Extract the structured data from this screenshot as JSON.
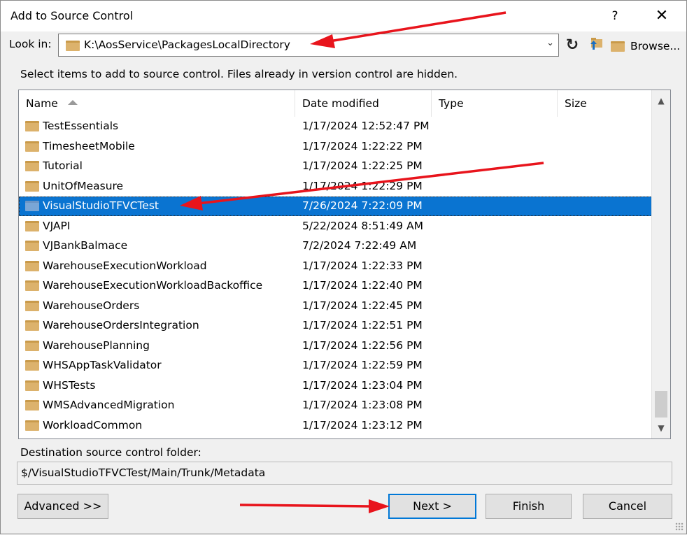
{
  "window": {
    "title": "Add to Source Control",
    "help": "?",
    "close": "✕"
  },
  "lookin": {
    "label": "Look in:",
    "path": "K:\\AosService\\PackagesLocalDirectory",
    "browse_label": "Browse..."
  },
  "instructions": "Select items to add to source control. Files already in version control are hidden.",
  "columns": [
    "Name",
    "Date modified",
    "Type",
    "Size"
  ],
  "rows": [
    {
      "name": "TestEssentials",
      "date": "1/17/2024 12:52:47 PM"
    },
    {
      "name": "TimesheetMobile",
      "date": "1/17/2024 1:22:22 PM"
    },
    {
      "name": "Tutorial",
      "date": "1/17/2024 1:22:25 PM"
    },
    {
      "name": "UnitOfMeasure",
      "date": "1/17/2024 1:22:29 PM"
    },
    {
      "name": "VisualStudioTFVCTest",
      "date": "7/26/2024 7:22:09 PM",
      "selected": true
    },
    {
      "name": "VJAPI",
      "date": "5/22/2024 8:51:49 AM"
    },
    {
      "name": "VJBankBalmace",
      "date": "7/2/2024 7:22:49 AM"
    },
    {
      "name": "WarehouseExecutionWorkload",
      "date": "1/17/2024 1:22:33 PM"
    },
    {
      "name": "WarehouseExecutionWorkloadBackoffice",
      "date": "1/17/2024 1:22:40 PM"
    },
    {
      "name": "WarehouseOrders",
      "date": "1/17/2024 1:22:45 PM"
    },
    {
      "name": "WarehouseOrdersIntegration",
      "date": "1/17/2024 1:22:51 PM"
    },
    {
      "name": "WarehousePlanning",
      "date": "1/17/2024 1:22:56 PM"
    },
    {
      "name": "WHSAppTaskValidator",
      "date": "1/17/2024 1:22:59 PM"
    },
    {
      "name": "WHSTests",
      "date": "1/17/2024 1:23:04 PM"
    },
    {
      "name": "WMSAdvancedMigration",
      "date": "1/17/2024 1:23:08 PM"
    },
    {
      "name": "WorkloadCommon",
      "date": "1/17/2024 1:23:12 PM"
    }
  ],
  "destination": {
    "label": "Destination source control folder:",
    "value": "$/VisualStudioTFVCTest/Main/Trunk/Metadata"
  },
  "buttons": {
    "advanced": "Advanced >>",
    "next": "Next >",
    "finish": "Finish",
    "cancel": "Cancel"
  },
  "colors": {
    "selection": "#0a74d1",
    "annotation_arrow": "#e8141c",
    "default_button_border": "#0078d7"
  }
}
